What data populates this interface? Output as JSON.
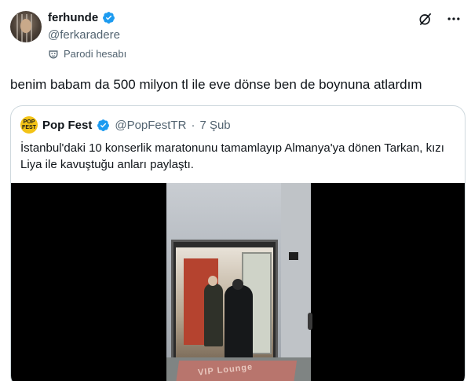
{
  "tweet": {
    "display_name": "ferhunde",
    "handle": "@ferkaradere",
    "parody_label": "Parodi hesabı",
    "text": "benim babam da 500 milyon tl ile eve dönse ben de boynuna atlardım",
    "verified_icon": "verified-badge-icon",
    "grok_icon": "grok-icon",
    "more_icon": "more-icon"
  },
  "quote": {
    "avatar_text": "POP FEST",
    "display_name": "Pop Fest",
    "handle": "@PopFestTR",
    "separator": "·",
    "date": "7 Şub",
    "text": "İstanbul'daki 10 konserlik maratonunu tamamlayıp Almanya'ya dönen Tarkan, kızı Liya ile kavuştuğu anları paylaştı.",
    "media": {
      "mat_text": "VIP Lounge"
    }
  },
  "colors": {
    "verified": "#1d9bf0",
    "secondary_text": "#536471",
    "border": "#cfd9de",
    "pop_fest_brand": "#f3c316"
  }
}
